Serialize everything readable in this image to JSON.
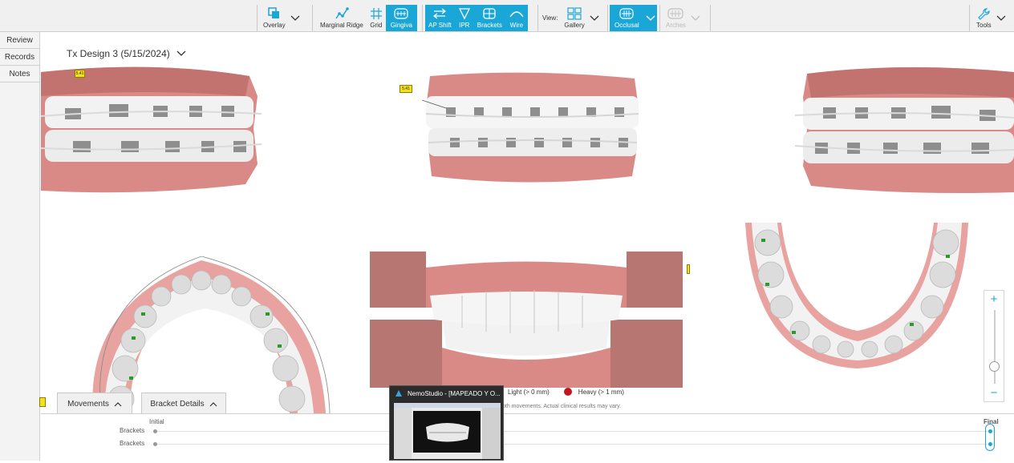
{
  "toolbar": {
    "overlay": "Overlay",
    "marginal_ridge": "Marginal Ridge",
    "grid": "Grid",
    "gingiva": "Gingiva",
    "ap_shift": "AP Shift",
    "ipr": "IPR",
    "brackets": "Brackets",
    "wire": "Wire",
    "view_label": "View:",
    "gallery": "Gallery",
    "occlusal": "Occlusal",
    "arches": "Arches",
    "tools": "Tools"
  },
  "sidebar": {
    "items": [
      {
        "label": "Review"
      },
      {
        "label": "Records"
      },
      {
        "label": "Notes"
      }
    ]
  },
  "main": {
    "design_title": "Tx Design 3 (5/15/2024)",
    "ipr_tag_1": "5.41",
    "ipr_tag_2": "5.41",
    "legend": {
      "light": "Light (> 0 mm)",
      "heavy": "Heavy (> 1 mm)"
    },
    "disclaimer": "oth movements. Actual clinical results may vary."
  },
  "bottom": {
    "movements_tab": "Movements",
    "bracket_details_tab": "Bracket Details",
    "initial_label": "Initial",
    "final_label": "Final",
    "rows": [
      "Brackets",
      "Brackets"
    ]
  },
  "taskbar_preview": {
    "title": "NemoStudio - [MAPEADO Y O..."
  },
  "colors": {
    "accent": "#1aa6d6",
    "gum": "#d98a87",
    "heavy": "#c3161c",
    "tag": "#f3e11d"
  }
}
